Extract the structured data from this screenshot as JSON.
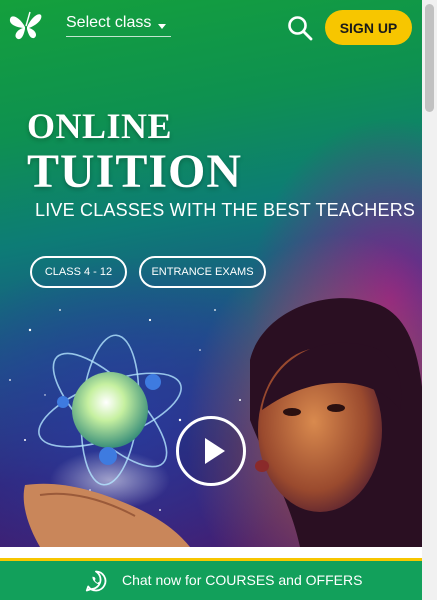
{
  "header": {
    "class_select_label": "Select class",
    "signup_label": "SIGN UP"
  },
  "hero": {
    "title_line1": "ONLINE",
    "title_line2": "TUITION",
    "tagline": "LIVE CLASSES WITH THE BEST TEACHERS",
    "buttons": [
      {
        "label": "CLASS 4 - 12"
      },
      {
        "label": "ENTRANCE EXAMS"
      }
    ]
  },
  "chat_bar": {
    "label": "Chat now for COURSES and OFFERS"
  },
  "icons": {
    "logo": "butterfly-logo-icon",
    "search": "search-icon",
    "play": "play-icon",
    "chat": "whatsapp-icon"
  },
  "colors": {
    "accent_yellow": "#f7c600",
    "chat_green": "#12a05b",
    "hero_green": "#14a03c",
    "hero_purple": "#4a1b6e"
  }
}
